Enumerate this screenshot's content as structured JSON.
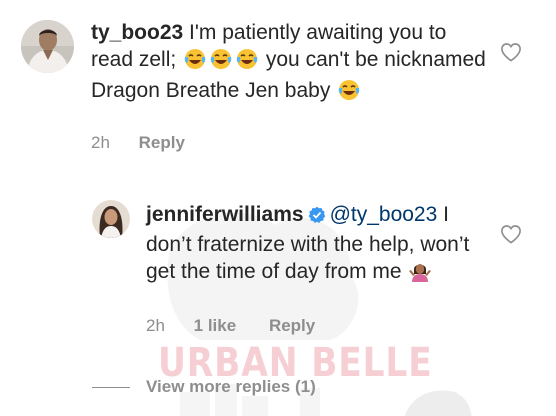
{
  "watermark": {
    "text": "URBAN BELLE"
  },
  "comments": [
    {
      "username": "ty_boo23",
      "text_part1": " I'm patiently awaiting you to read zell; ",
      "emojis_inline": [
        "face-with-tears-of-joy",
        "face-with-tears-of-joy",
        "face-with-tears-of-joy"
      ],
      "text_part2": " you can't be nicknamed Dragon Breathe Jen baby ",
      "emoji_end": "face-with-tears-of-joy",
      "time": "2h",
      "reply_label": "Reply"
    }
  ],
  "reply": {
    "username": "jenniferwilliams",
    "verified": true,
    "mention": "@ty_boo23",
    "text": " I don’t fraternize with the help, won’t get the time of day from me ",
    "emoji_end": "woman-shrugging",
    "time": "2h",
    "likes": "1 like",
    "reply_label": "Reply"
  },
  "view_more": {
    "label": "View more replies (1)"
  },
  "colors": {
    "text": "#262626",
    "muted": "#8e8e8e",
    "mention": "#00376b",
    "verified": "#3897f0",
    "watermark": "#e68c96"
  }
}
